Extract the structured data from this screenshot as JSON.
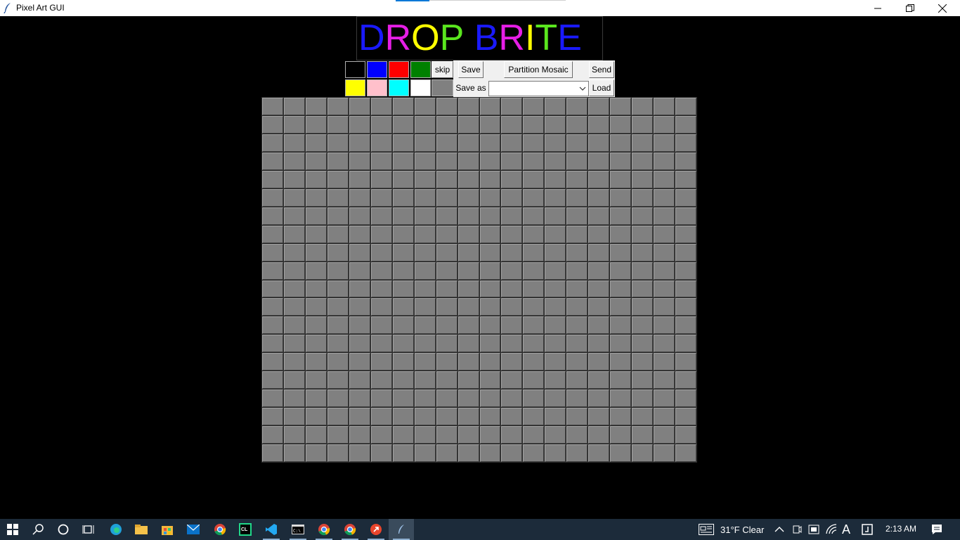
{
  "window": {
    "title": "Pixel Art GUI",
    "minimize_icon": "minimize-icon",
    "restore_icon": "restore-icon",
    "close_icon": "close-icon"
  },
  "logo": {
    "letters": [
      {
        "char": "D",
        "color": "#1a1aff"
      },
      {
        "char": "R",
        "color": "#e61ee6"
      },
      {
        "char": "O",
        "color": "#ffff00"
      },
      {
        "char": "P",
        "color": "#5ae61e"
      },
      {
        "char": " ",
        "color": "#000000"
      },
      {
        "char": "B",
        "color": "#1a1aff"
      },
      {
        "char": "R",
        "color": "#e61ee6"
      },
      {
        "char": "I",
        "color": "#ffff00"
      },
      {
        "char": "T",
        "color": "#5ae61e"
      },
      {
        "char": "E",
        "color": "#1a1aff"
      }
    ]
  },
  "palette": {
    "row1": [
      "#000000",
      "#0000ff",
      "#ff0000",
      "#008000"
    ],
    "row2": [
      "#ffff00",
      "#ffc0cb",
      "#00ffff",
      "#ffffff"
    ],
    "skip_label": "skip",
    "gray_swatch": "#808080"
  },
  "toolbar": {
    "save_label": "Save",
    "partition_label": "Partition Mosaic",
    "send_label": "Send",
    "save_as_label": "Save as",
    "load_label": "Load",
    "combo_value": ""
  },
  "canvas": {
    "rows": 20,
    "cols": 20,
    "cell_color": "#808080"
  },
  "taskbar": {
    "icons": [
      "windows-start-icon",
      "search-icon",
      "cortana-icon",
      "task-view-icon",
      "edge-icon",
      "file-explorer-icon",
      "store-icon",
      "mail-icon",
      "chrome-icon",
      "clion-icon",
      "vscode-icon",
      "terminal-icon",
      "chrome-icon",
      "chrome-icon",
      "app-icon",
      "python-feather-icon"
    ],
    "weather": "31°F  Clear",
    "time": "2:13 AM"
  }
}
